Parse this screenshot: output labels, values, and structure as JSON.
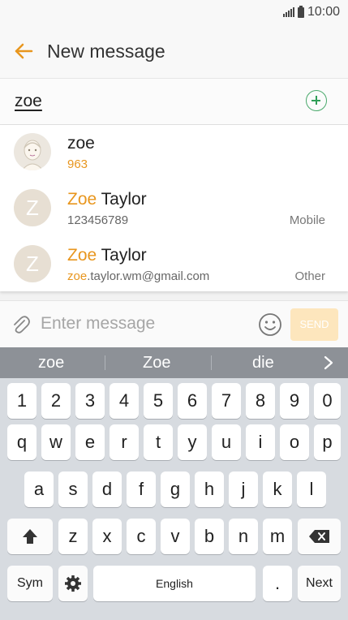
{
  "status": {
    "time": "10:00"
  },
  "header": {
    "title": "New message"
  },
  "recipient": {
    "value": "zoe"
  },
  "suggestions": [
    {
      "name_hl": "",
      "name_rest": "zoe",
      "detail_hl": "",
      "detail_rest": "963",
      "type": ""
    },
    {
      "name_hl": "Zoe",
      "name_rest": " Taylor",
      "detail_hl": "",
      "detail_rest": "123456789",
      "type": "Mobile",
      "initial": "Z"
    },
    {
      "name_hl": "Zoe",
      "name_rest": " Taylor",
      "detail_hl": "zoe",
      "detail_rest": ".taylor.wm@gmail.com",
      "type": "Other",
      "initial": "Z"
    }
  ],
  "compose": {
    "placeholder": "Enter message",
    "send_label": "SEND"
  },
  "keyboard": {
    "predictions": [
      "zoe",
      "Zoe",
      "die"
    ],
    "numbers": [
      "1",
      "2",
      "3",
      "4",
      "5",
      "6",
      "7",
      "8",
      "9",
      "0"
    ],
    "row1": [
      "q",
      "w",
      "e",
      "r",
      "t",
      "y",
      "u",
      "i",
      "o",
      "p"
    ],
    "row2": [
      "a",
      "s",
      "d",
      "f",
      "g",
      "h",
      "j",
      "k",
      "l"
    ],
    "row3": [
      "z",
      "x",
      "c",
      "v",
      "b",
      "n",
      "m"
    ],
    "sym_label": "Sym",
    "space_label": "English",
    "period_label": ".",
    "next_label": "Next"
  },
  "colors": {
    "accent": "#e8961e",
    "add_green": "#2f9e57",
    "send_bg": "#fde6bd"
  }
}
